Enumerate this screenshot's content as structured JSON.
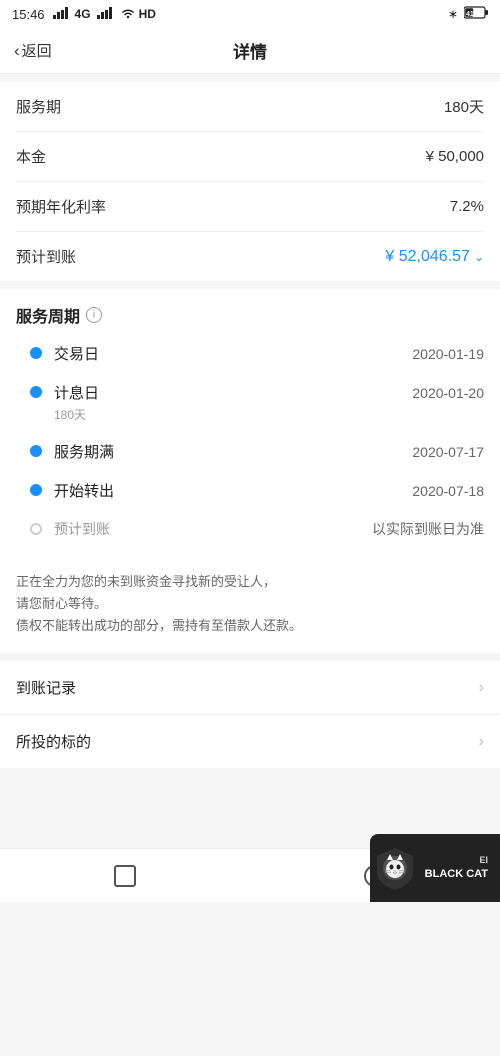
{
  "statusBar": {
    "time": "15:46",
    "signal": "4G",
    "wifi": "HD",
    "bluetooth": "BT",
    "battery": "41"
  },
  "nav": {
    "back": "返回",
    "title": "详情"
  },
  "infoSection": {
    "rows": [
      {
        "label": "服务期",
        "value": "180天",
        "type": "normal"
      },
      {
        "label": "本金",
        "value": "¥ 50,000",
        "type": "normal"
      },
      {
        "label": "预期年化利率",
        "value": "7.2%",
        "type": "normal"
      },
      {
        "label": "预计到账",
        "value": "¥ 52,046.57",
        "type": "blue"
      }
    ]
  },
  "periodSection": {
    "title": "服务周期",
    "infoIcon": "i",
    "timeline": [
      {
        "label": "交易日",
        "date": "2020-01-19",
        "dot": "filled",
        "sub": null
      },
      {
        "label": "计息日",
        "date": "2020-01-20",
        "dot": "filled",
        "sub": "180天"
      },
      {
        "label": "服务期满",
        "date": "2020-07-17",
        "dot": "filled",
        "sub": null
      },
      {
        "label": "开始转出",
        "date": "2020-07-18",
        "dot": "filled",
        "sub": null
      },
      {
        "label": "预计到账",
        "date": "以实际到账日为准",
        "dot": "empty",
        "sub": null
      }
    ],
    "notice": "正在全力为您的未到账资金寻找新的受让人，\n请您耐心等待。\n债权不能转出成功的部分，需持有至借款人还款。"
  },
  "listSection": {
    "rows": [
      {
        "label": "到账记录"
      },
      {
        "label": "所投的标的"
      }
    ]
  },
  "blackcat": {
    "ei": "EI",
    "name": "BLACK CAT",
    "alt": "黑猫"
  }
}
